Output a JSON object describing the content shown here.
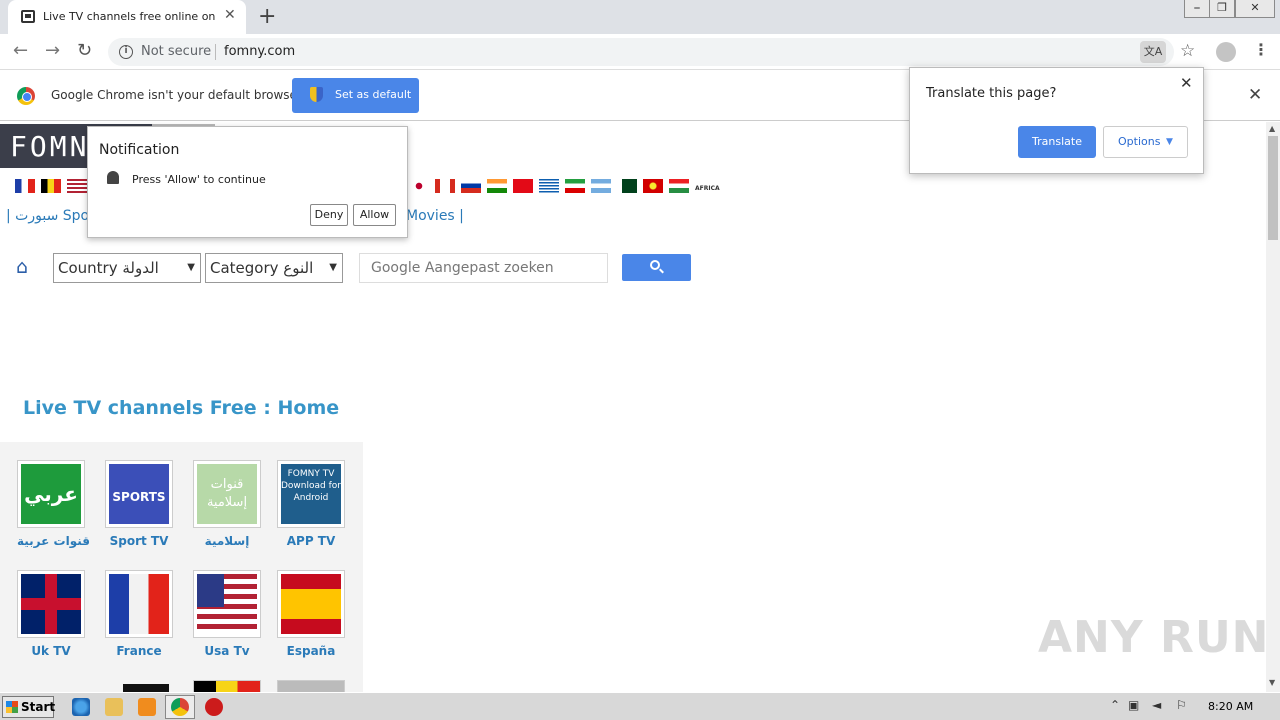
{
  "browser": {
    "tab_title": "Live TV channels free online on Internet",
    "tab_close": "✕",
    "new_tab": "+",
    "security_label": "Not secure",
    "url": "fomny.com",
    "window_controls": [
      "⎯",
      "❐",
      "✕"
    ]
  },
  "infobar": {
    "message": "Google Chrome isn't your default browser",
    "button": "Set as default",
    "close": "✕"
  },
  "translate_popup": {
    "title": "Translate this page?",
    "translate_button": "Translate",
    "options_button": "Options",
    "close": "✕"
  },
  "notification": {
    "title": "Notification",
    "message": "Press 'Allow' to continue",
    "deny": "Deny",
    "allow": "Allow"
  },
  "site": {
    "logo": "FOMNY",
    "nav_left": "| سبورت Spo",
    "nav_right": "Movies  |",
    "country_select": "Country الدولة",
    "category_select": "Category النوع",
    "search_placeholder": "Google Aangepast zoeken",
    "heading": "Live TV channels Free : Home",
    "africa_label": "AFRICA",
    "tiles": [
      {
        "label": "قنوات عربية",
        "img_text": "عربي"
      },
      {
        "label": "Sport TV",
        "img_text": "SPORTS"
      },
      {
        "label": "إسلامية",
        "img_text": "قنوات إسلامية"
      },
      {
        "label": "APP TV",
        "img_text": "FOMNY TV Download for Android"
      },
      {
        "label": "Uk TV",
        "img_text": ""
      },
      {
        "label": "France",
        "img_text": ""
      },
      {
        "label": "Usa Tv",
        "img_text": ""
      },
      {
        "label": "España",
        "img_text": ""
      }
    ]
  },
  "watermark": "ANY RUN",
  "taskbar": {
    "start": "Start",
    "clock": "8:20 AM"
  }
}
